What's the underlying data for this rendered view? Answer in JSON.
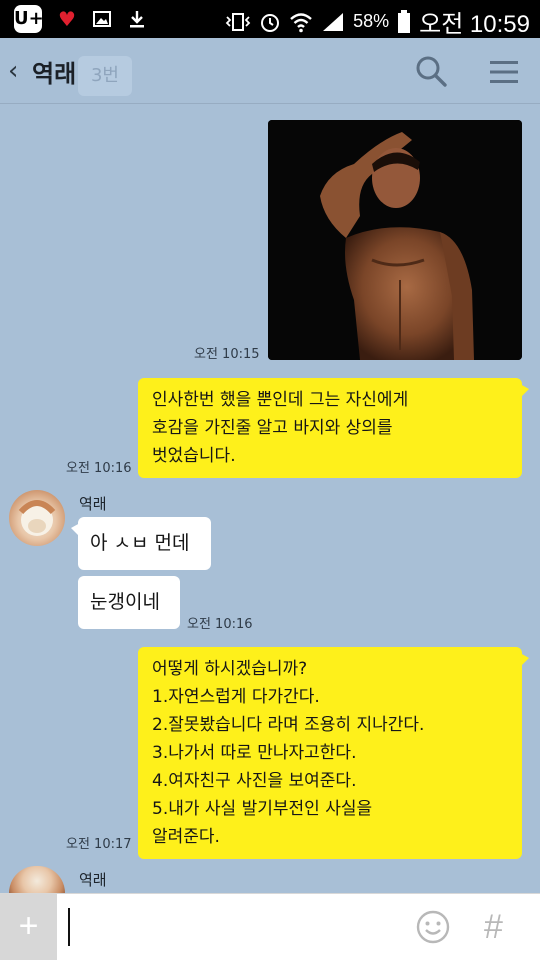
{
  "status_bar": {
    "app_badge": "U+",
    "battery": "58%",
    "time": "오전 10:59",
    "icons": [
      "heart-icon",
      "image-icon",
      "download-icon",
      "vibrate-icon",
      "alarm-icon",
      "wifi-icon",
      "signal-icon",
      "battery-icon"
    ]
  },
  "header": {
    "back_glyph": "‹",
    "title": "역래",
    "ghost_label": "3번"
  },
  "messages": [
    {
      "type": "image",
      "from": "me",
      "time": "오전 10:15"
    },
    {
      "type": "text",
      "from": "me",
      "time": "오전 10:16",
      "lines": [
        "인사한번 했을 뿐인데 그는 자신에게",
        "호감을 가진줄 알고 바지와 상의를",
        "벗었습니다."
      ]
    },
    {
      "type": "text",
      "from": "other",
      "sender": "역래",
      "lines": [
        "아 ㅅㅂ 먼데"
      ]
    },
    {
      "type": "text",
      "from": "other",
      "time": "오전 10:16",
      "lines": [
        "눈갱이네"
      ]
    },
    {
      "type": "text",
      "from": "me",
      "time": "오전 10:17",
      "lines": [
        "어떻게 하시겠습니까?",
        "1.자연스럽게 다가간다.",
        "2.잘못봤습니다 라며 조용히 지나간다.",
        "3.나가서 따로 만나자고한다.",
        "4.여자친구 사진을 보여준다.",
        "5.내가 사실 발기부전인 사실을",
        "알려준다."
      ]
    },
    {
      "type": "sender_only",
      "from": "other",
      "sender": "역래"
    }
  ],
  "input": {
    "plus_label": "+",
    "hash_label": "#",
    "value": ""
  },
  "colors": {
    "chat_background": "#a8bfd6",
    "my_bubble": "#fef01b",
    "other_bubble": "#ffffff"
  }
}
